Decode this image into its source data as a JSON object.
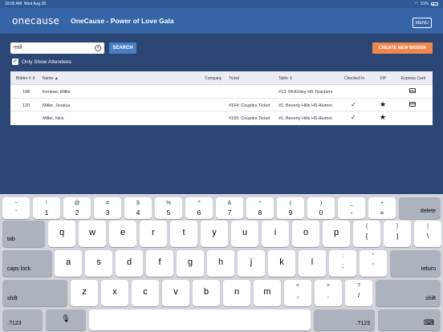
{
  "status": {
    "time": "10:05 AM",
    "date": "Wed Aug 28",
    "battery": "21%"
  },
  "header": {
    "logo": "onecause",
    "title": "OneCause - Power of Love Gala",
    "menu": "MENU"
  },
  "search": {
    "value": "mill",
    "button": "SEARCH",
    "create": "CREATE NEW BIDDER",
    "only_attendees": "Only Show Attendees"
  },
  "table": {
    "headers": {
      "bidder": "Bidder # ⇕",
      "name": "Name ▲",
      "company": "Company",
      "ticket": "Ticket",
      "table": "Table ⇕",
      "checked": "Checked In",
      "vip": "VIP",
      "express": "Express Card"
    },
    "rows": [
      {
        "bidder": "198",
        "name": "Kentner, Millie",
        "company": "",
        "ticket": "",
        "table": "#13: McKinley HS Teachers",
        "checked": false,
        "vip": false,
        "express": true
      },
      {
        "bidder": "120",
        "name": "Miller, Jessica",
        "company": "",
        "ticket": "#164: Couples Ticket",
        "table": "#1: Beverly Hills HS Alumni",
        "checked": true,
        "vip": true,
        "express": true
      },
      {
        "bidder": "",
        "name": "Miller, Nick",
        "company": "",
        "ticket": "#165: Couples Ticket",
        "table": "#1: Beverly Hills HS Alumni",
        "checked": true,
        "vip": true,
        "express": false
      }
    ]
  },
  "keyboard": {
    "row1": [
      [
        "~",
        "`"
      ],
      [
        "!",
        "1"
      ],
      [
        "@",
        "2"
      ],
      [
        "#",
        "3"
      ],
      [
        "$",
        "4"
      ],
      [
        "%",
        "5"
      ],
      [
        "^",
        "6"
      ],
      [
        "&",
        "7"
      ],
      [
        "*",
        "8"
      ],
      [
        "(",
        "9"
      ],
      [
        ")",
        "0"
      ],
      [
        "_",
        "-"
      ],
      [
        "+",
        "="
      ]
    ],
    "row2": [
      [
        "",
        "q"
      ],
      [
        "",
        "w"
      ],
      [
        "",
        "e"
      ],
      [
        "",
        "r"
      ],
      [
        "",
        "t"
      ],
      [
        "",
        "y"
      ],
      [
        "",
        "u"
      ],
      [
        "",
        "i"
      ],
      [
        "",
        "o"
      ],
      [
        "",
        "p"
      ],
      [
        "{",
        "["
      ],
      [
        "}",
        "]"
      ],
      [
        "|",
        "\\"
      ]
    ],
    "row3": [
      [
        "",
        "a"
      ],
      [
        "",
        "s"
      ],
      [
        "",
        "d"
      ],
      [
        "",
        "f"
      ],
      [
        "",
        "g"
      ],
      [
        "",
        "h"
      ],
      [
        "",
        "j"
      ],
      [
        "",
        "k"
      ],
      [
        "",
        "l"
      ],
      [
        ":",
        ";"
      ],
      [
        "\"",
        "'"
      ]
    ],
    "row4": [
      [
        "",
        "z"
      ],
      [
        "",
        "x"
      ],
      [
        "",
        "c"
      ],
      [
        "",
        "v"
      ],
      [
        "",
        "b"
      ],
      [
        "",
        "n"
      ],
      [
        "",
        "m"
      ],
      [
        "<",
        ","
      ],
      [
        ">",
        "."
      ],
      [
        "?",
        "/"
      ]
    ],
    "delete": "delete",
    "tab": "tab",
    "caps": "caps lock",
    "return": "return",
    "shift": "shift",
    "num": ".?123"
  }
}
